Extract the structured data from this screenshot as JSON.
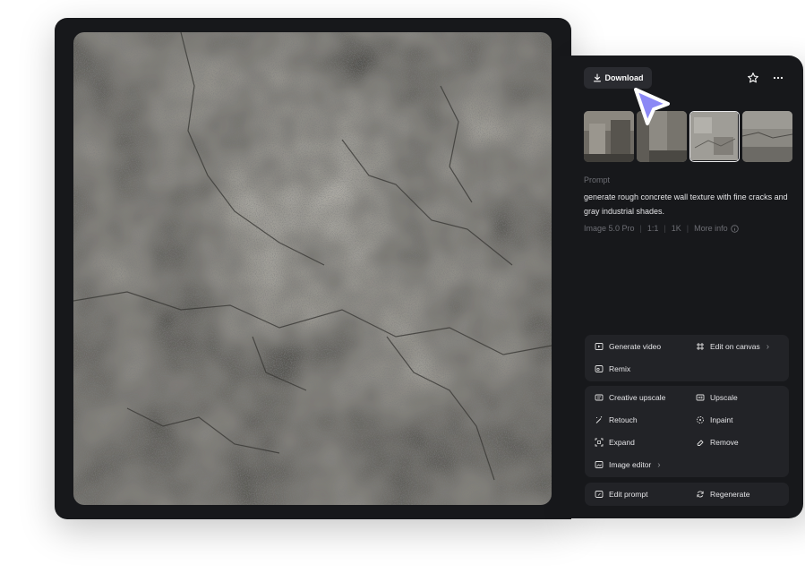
{
  "toolbar": {
    "download_label": "Download"
  },
  "thumbnails": [
    {
      "name": "thumbnail-1",
      "selected": false
    },
    {
      "name": "thumbnail-2",
      "selected": false
    },
    {
      "name": "thumbnail-3",
      "selected": true
    },
    {
      "name": "thumbnail-4",
      "selected": false
    }
  ],
  "prompt": {
    "label": "Prompt",
    "text": "generate rough concrete wall texture with fine cracks and gray industrial shades."
  },
  "meta": {
    "model": "Image 5.0 Pro",
    "ratio": "1:1",
    "resolution": "1K",
    "more_info": "More info"
  },
  "actions": {
    "generate_video": "Generate video",
    "edit_on_canvas": "Edit on canvas",
    "remix": "Remix",
    "creative_upscale": "Creative upscale",
    "upscale": "Upscale",
    "retouch": "Retouch",
    "inpaint": "Inpaint",
    "expand": "Expand",
    "remove": "Remove",
    "image_editor": "Image editor",
    "edit_prompt": "Edit prompt",
    "regenerate": "Regenerate"
  },
  "colors": {
    "panel_bg": "#17181b",
    "group_bg": "#222327",
    "cursor": "#8b88f5"
  }
}
